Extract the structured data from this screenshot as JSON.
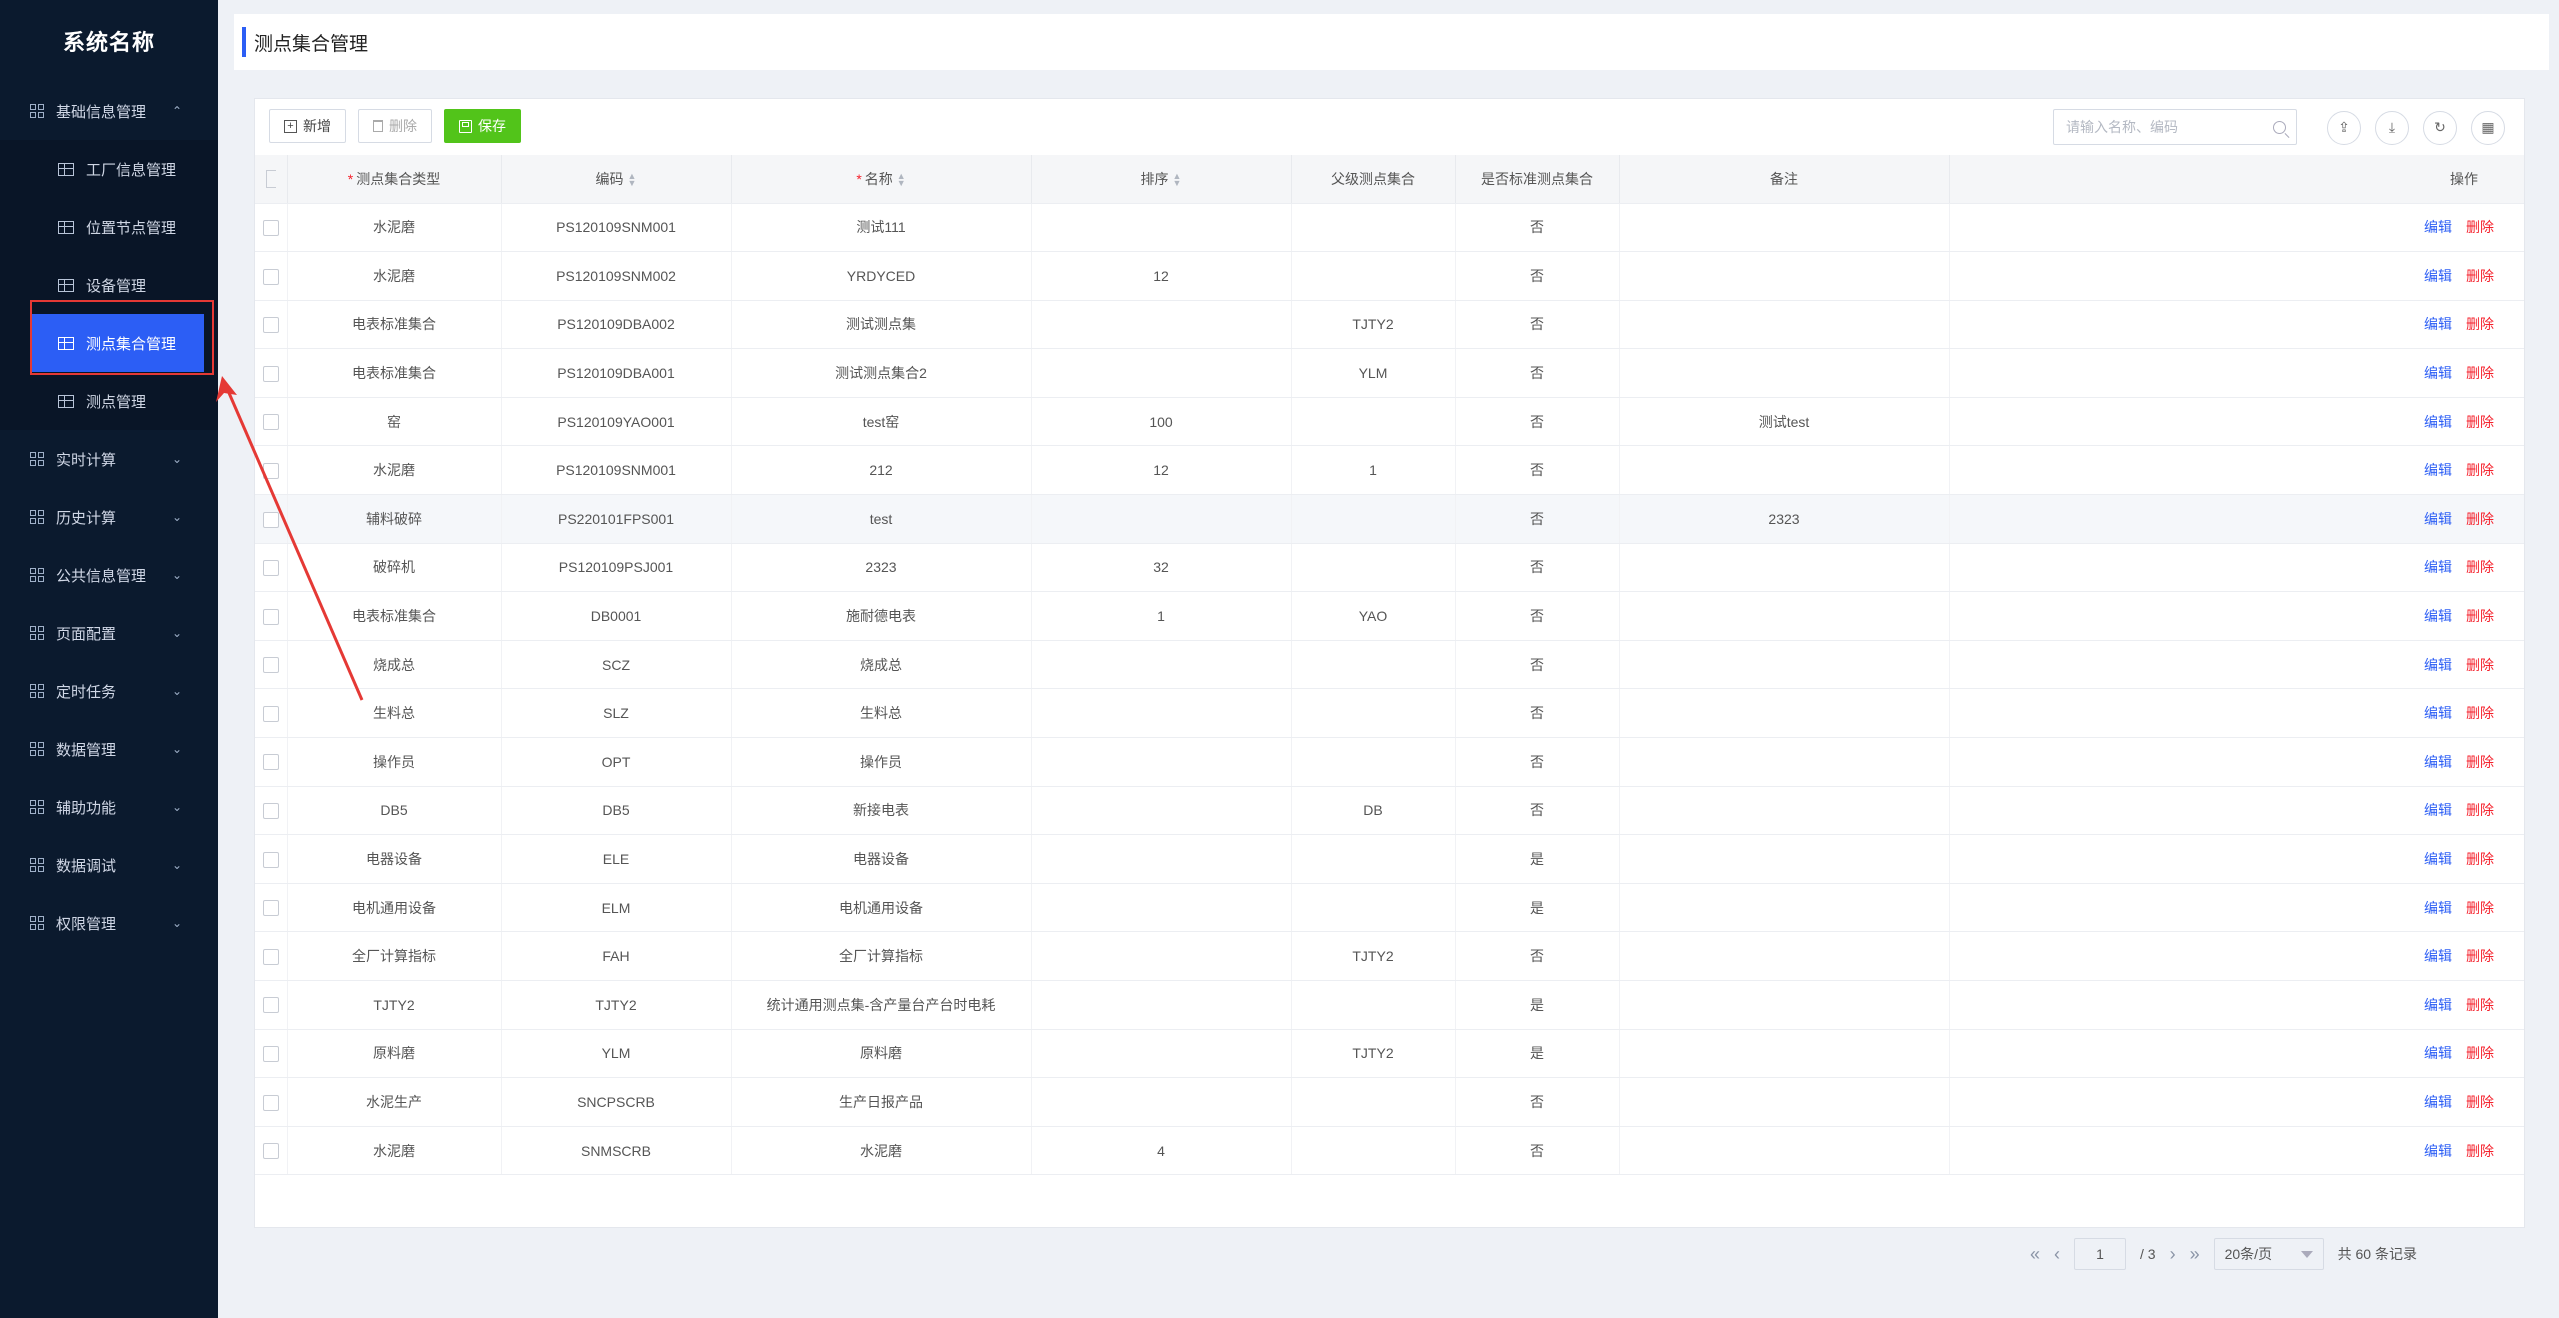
{
  "brand": "系统名称",
  "sidebar": {
    "groups": [
      {
        "label": "基础信息管理",
        "chevron": "chevron-up-icon",
        "expanded": true
      },
      {
        "label": "实时计算"
      },
      {
        "label": "历史计算"
      },
      {
        "label": "公共信息管理"
      },
      {
        "label": "页面配置"
      },
      {
        "label": "定时任务"
      },
      {
        "label": "数据管理"
      },
      {
        "label": "辅助功能"
      },
      {
        "label": "数据调试"
      },
      {
        "label": "权限管理"
      }
    ],
    "subitems": [
      {
        "label": "工厂信息管理"
      },
      {
        "label": "位置节点管理"
      },
      {
        "label": "设备管理"
      },
      {
        "label": "测点集合管理",
        "active": true
      },
      {
        "label": "测点管理"
      }
    ]
  },
  "header": {
    "title": "测点集合管理"
  },
  "toolbar": {
    "add": "新增",
    "delete": "删除",
    "save": "保存"
  },
  "search": {
    "placeholder": "请输入名称、编码"
  },
  "columns": {
    "type": "测点集合类型",
    "code": "编码",
    "name": "名称",
    "order": "排序",
    "parent": "父级测点集合",
    "standard": "是否标准测点集合",
    "remark": "备注",
    "action": "操作"
  },
  "actions": {
    "edit": "编辑",
    "delete": "删除"
  },
  "rows": [
    {
      "type": "水泥磨",
      "code": "PS120109SNM001",
      "name": "测试111",
      "order": "",
      "parent": "",
      "standard": "否",
      "remark": ""
    },
    {
      "type": "水泥磨",
      "code": "PS120109SNM002",
      "name": "YRDYCED",
      "order": "12",
      "parent": "",
      "standard": "否",
      "remark": ""
    },
    {
      "type": "电表标准集合",
      "code": "PS120109DBA002",
      "name": "测试测点集",
      "order": "",
      "parent": "TJTY2",
      "standard": "否",
      "remark": ""
    },
    {
      "type": "电表标准集合",
      "code": "PS120109DBA001",
      "name": "测试测点集合2",
      "order": "",
      "parent": "YLM",
      "standard": "否",
      "remark": ""
    },
    {
      "type": "窑",
      "code": "PS120109YAO001",
      "name": "test窑",
      "order": "100",
      "parent": "",
      "standard": "否",
      "remark": "测试test"
    },
    {
      "type": "水泥磨",
      "code": "PS120109SNM001",
      "name": "212",
      "order": "12",
      "parent": "1",
      "standard": "否",
      "remark": ""
    },
    {
      "type": "辅料破碎",
      "code": "PS220101FPS001",
      "name": "test",
      "order": "",
      "parent": "",
      "standard": "否",
      "remark": "2323"
    },
    {
      "type": "破碎机",
      "code": "PS120109PSJ001",
      "name": "2323",
      "order": "32",
      "parent": "",
      "standard": "否",
      "remark": ""
    },
    {
      "type": "电表标准集合",
      "code": "DB0001",
      "name": "施耐德电表",
      "order": "1",
      "parent": "YAO",
      "standard": "否",
      "remark": ""
    },
    {
      "type": "烧成总",
      "code": "SCZ",
      "name": "烧成总",
      "order": "",
      "parent": "",
      "standard": "否",
      "remark": ""
    },
    {
      "type": "生料总",
      "code": "SLZ",
      "name": "生料总",
      "order": "",
      "parent": "",
      "standard": "否",
      "remark": ""
    },
    {
      "type": "操作员",
      "code": "OPT",
      "name": "操作员",
      "order": "",
      "parent": "",
      "standard": "否",
      "remark": ""
    },
    {
      "type": "DB5",
      "code": "DB5",
      "name": "新接电表",
      "order": "",
      "parent": "DB",
      "standard": "否",
      "remark": ""
    },
    {
      "type": "电器设备",
      "code": "ELE",
      "name": "电器设备",
      "order": "",
      "parent": "",
      "standard": "是",
      "remark": ""
    },
    {
      "type": "电机通用设备",
      "code": "ELM",
      "name": "电机通用设备",
      "order": "",
      "parent": "",
      "standard": "是",
      "remark": ""
    },
    {
      "type": "全厂计算指标",
      "code": "FAH",
      "name": "全厂计算指标",
      "order": "",
      "parent": "TJTY2",
      "standard": "否",
      "remark": ""
    },
    {
      "type": "TJTY2",
      "code": "TJTY2",
      "name": "统计通用测点集-含产量台产台时电耗",
      "order": "",
      "parent": "",
      "standard": "是",
      "remark": ""
    },
    {
      "type": "原料磨",
      "code": "YLM",
      "name": "原料磨",
      "order": "",
      "parent": "TJTY2",
      "standard": "是",
      "remark": ""
    },
    {
      "type": "水泥生产",
      "code": "SNCPSCRB",
      "name": "生产日报产品",
      "order": "",
      "parent": "",
      "standard": "否",
      "remark": ""
    },
    {
      "type": "水泥磨",
      "code": "SNMSCRB",
      "name": "水泥磨",
      "order": "4",
      "parent": "",
      "standard": "否",
      "remark": ""
    }
  ],
  "pagination": {
    "current": "1",
    "total_pages": "/ 3",
    "page_size": "20条/页",
    "total": "共 60 条记录"
  },
  "colors": {
    "sidebar": "#0b1a2e",
    "accent": "#2c5ef5",
    "save": "#52c41a",
    "danger": "#f5222d",
    "annotation": "#e53935"
  }
}
